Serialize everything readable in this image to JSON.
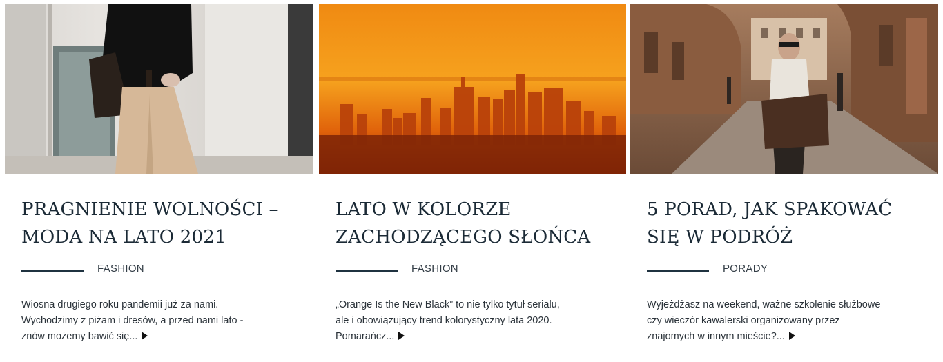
{
  "posts": [
    {
      "image": "woman-with-leather-bag-photo",
      "title_line1": "PRAGNIENIE WOLNOŚCI –",
      "title_line2": "MODA NA LATO 2021",
      "category": "FASHION",
      "excerpt_line1": "Wiosna drugiego roku pandemii już za nami.",
      "excerpt_line2": "Wychodzimy z piżam i dresów, a przed nami lato -",
      "excerpt_line3": "znów możemy bawić się...",
      "more_icon": "play-arrow-icon"
    },
    {
      "image": "orange-sunset-skyline-photo",
      "title_line1": "LATO W KOLORZE",
      "title_line2": "ZACHODZĄCEGO SŁOŃCA",
      "category": "FASHION",
      "excerpt_line1": "„Orange Is the New Black” to nie tylko tytuł serialu,",
      "excerpt_line2": "ale i obowiązujący trend kolorystyczny lata 2020.",
      "excerpt_line3": "Pomarańcz...",
      "more_icon": "play-arrow-icon"
    },
    {
      "image": "man-with-travel-bag-street-photo",
      "title_line1": "5 PORAD, JAK SPAKOWAĆ",
      "title_line2": "SIĘ W PODRÓŻ",
      "category": "PORADY",
      "excerpt_line1": "Wyjeżdżasz na weekend, ważne szkolenie służbowe",
      "excerpt_line2": "czy wieczór kawalerski organizowany przez",
      "excerpt_line3": "znajomych w innym mieście?...",
      "more_icon": "play-arrow-icon"
    }
  ],
  "colors": {
    "title": "#1b2a36",
    "divider": "#1f3240",
    "text": "#2b333a"
  }
}
